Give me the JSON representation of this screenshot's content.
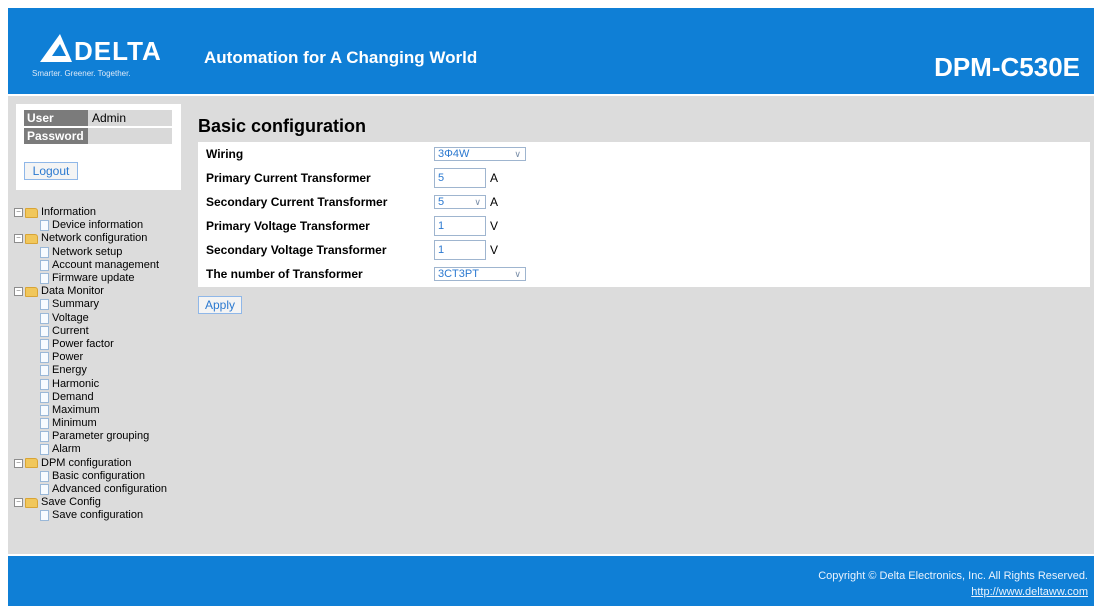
{
  "header": {
    "brand": "DELTA",
    "tagline": "Smarter. Greener. Together.",
    "slogan": "Automation for A Changing World",
    "model": "DPM-C530E",
    "color": "#0f7fd6"
  },
  "login": {
    "user_label": "User",
    "user_value": "Admin",
    "password_label": "Password",
    "password_value": "",
    "logout_label": "Logout"
  },
  "tree": [
    {
      "label": "Information",
      "type": "folder"
    },
    {
      "label": "Device information",
      "type": "page"
    },
    {
      "label": "Network configuration",
      "type": "folder"
    },
    {
      "label": "Network setup",
      "type": "page"
    },
    {
      "label": "Account management",
      "type": "page"
    },
    {
      "label": "Firmware update",
      "type": "page"
    },
    {
      "label": "Data Monitor",
      "type": "folder"
    },
    {
      "label": "Summary",
      "type": "page"
    },
    {
      "label": "Voltage",
      "type": "page"
    },
    {
      "label": "Current",
      "type": "page"
    },
    {
      "label": "Power factor",
      "type": "page"
    },
    {
      "label": "Power",
      "type": "page"
    },
    {
      "label": "Energy",
      "type": "page"
    },
    {
      "label": "Harmonic",
      "type": "page"
    },
    {
      "label": "Demand",
      "type": "page"
    },
    {
      "label": "Maximum",
      "type": "page"
    },
    {
      "label": "Minimum",
      "type": "page"
    },
    {
      "label": "Parameter grouping",
      "type": "page"
    },
    {
      "label": "Alarm",
      "type": "page"
    },
    {
      "label": "DPM configuration",
      "type": "folder"
    },
    {
      "label": "Basic configuration",
      "type": "page"
    },
    {
      "label": "Advanced configuration",
      "type": "page"
    },
    {
      "label": "Save Config",
      "type": "folder"
    },
    {
      "label": "Save configuration",
      "type": "page"
    }
  ],
  "main": {
    "title": "Basic configuration",
    "fields": {
      "wiring": {
        "label": "Wiring",
        "value": "3Φ4W"
      },
      "primary_ct": {
        "label": "Primary Current Transformer",
        "value": "5",
        "unit": "A"
      },
      "secondary_ct": {
        "label": "Secondary Current Transformer",
        "value": "5",
        "unit": "A"
      },
      "primary_vt": {
        "label": "Primary Voltage Transformer",
        "value": "1",
        "unit": "V"
      },
      "secondary_vt": {
        "label": "Secondary Voltage Transformer",
        "value": "1",
        "unit": "V"
      },
      "num_transformer": {
        "label": "The number of Transformer",
        "value": "3CT3PT"
      }
    },
    "apply_label": "Apply"
  },
  "footer": {
    "copyright": "Copyright © Delta Electronics, Inc. All Rights Reserved.",
    "url": "http://www.deltaww.com"
  }
}
